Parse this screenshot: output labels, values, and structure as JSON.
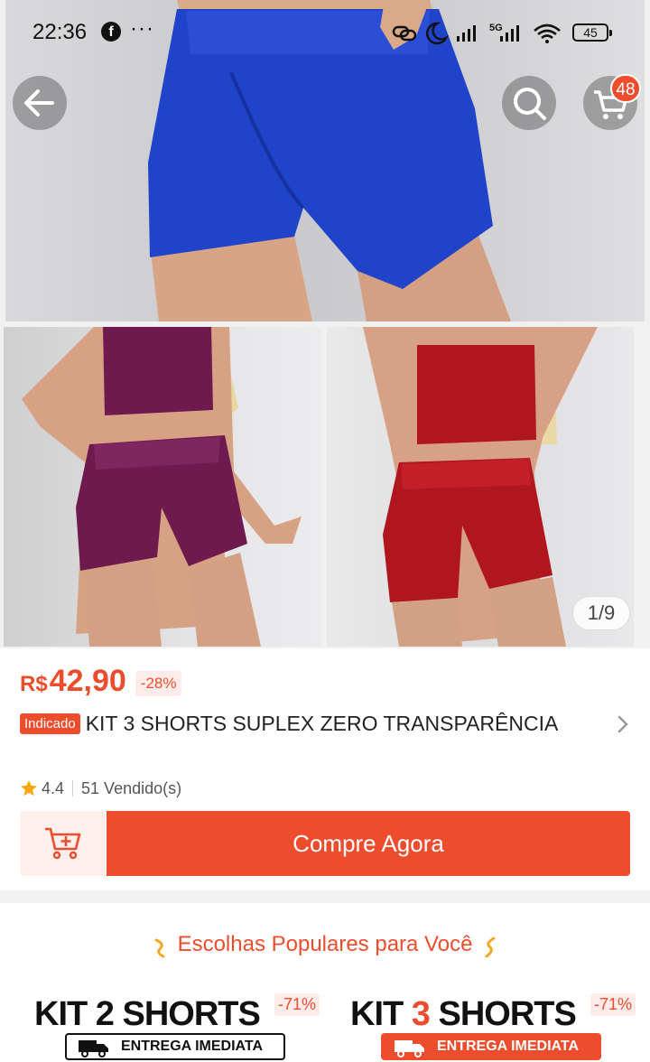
{
  "status_bar": {
    "time": "22:36",
    "dots": "···",
    "network": "5G",
    "battery": "45"
  },
  "nav": {
    "cart_badge": "48"
  },
  "gallery": {
    "counter": "1/9",
    "colors": {
      "top_shorts": "#1f43c9",
      "left_outfit": "#6e1a4f",
      "right_outfit": "#b0161d"
    }
  },
  "product": {
    "currency": "R$",
    "price": "42,90",
    "discount": "-28%",
    "tag": "Indicado",
    "title": "KIT 3 SHORTS SUPLEX ZERO TRANSPARÊNCIA",
    "rating": "4.4",
    "sold": "51 Vendido(s)"
  },
  "actions": {
    "buy_label": "Compre Agora"
  },
  "popular": {
    "heading": "Escolhas Populares para Você",
    "cards": [
      {
        "title_pre": "KIT ",
        "title_num": "2",
        "title_post": " SHORTS",
        "discount": "-71%",
        "shipping": "ENTREGA IMEDIATA"
      },
      {
        "title_pre": "KIT ",
        "title_num": "3",
        "title_post": " SHORTS",
        "discount": "-71%",
        "shipping": "ENTREGA IMEDIATA"
      }
    ]
  },
  "theme": {
    "accent": "#ee4d2d"
  }
}
